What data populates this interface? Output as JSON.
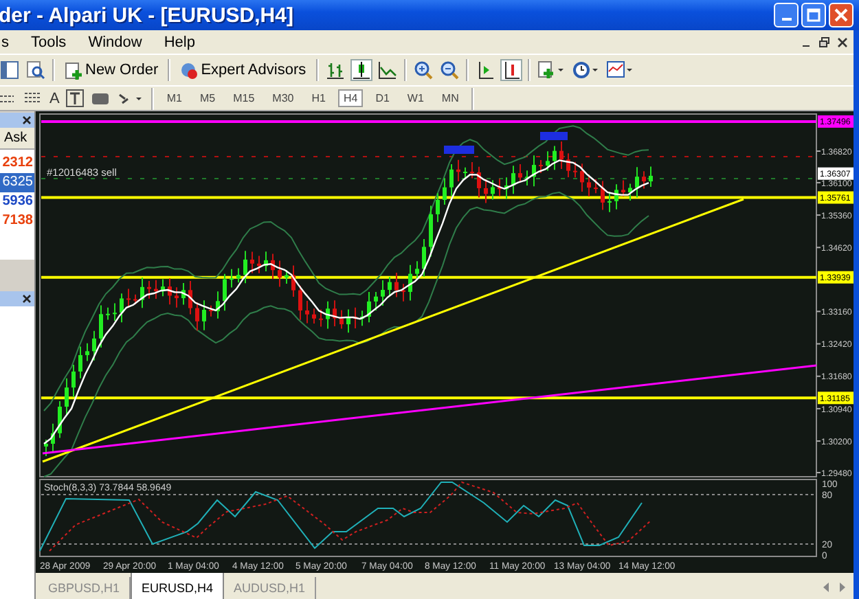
{
  "window": {
    "title": "der - Alpari UK - [EURUSD,H4]"
  },
  "menu": [
    "s",
    "Tools",
    "Window",
    "Help"
  ],
  "toolbar": {
    "buttons": [
      {
        "label": "New Order"
      },
      {
        "label": "Expert Advisors"
      }
    ],
    "text_tool": "A"
  },
  "timeframes": [
    {
      "label": "M1",
      "selected": false
    },
    {
      "label": "M5",
      "selected": false
    },
    {
      "label": "M15",
      "selected": false
    },
    {
      "label": "M30",
      "selected": false
    },
    {
      "label": "H1",
      "selected": false
    },
    {
      "label": "H4",
      "selected": true
    },
    {
      "label": "D1",
      "selected": false
    },
    {
      "label": "W1",
      "selected": false
    },
    {
      "label": "MN",
      "selected": false
    }
  ],
  "market_watch": {
    "column": "Ask",
    "rows": [
      {
        "ask": "2312",
        "selected": false,
        "color": "#e8400c"
      },
      {
        "ask": "6325",
        "selected": true
      },
      {
        "ask": "5936",
        "selected": false,
        "color": "#1c48c4"
      },
      {
        "ask": "7138",
        "selected": false,
        "color": "#e8400c"
      }
    ]
  },
  "chart": {
    "order_label": "#12016483 sell",
    "price_axis": [
      {
        "text": "1.37496",
        "kind": "level",
        "color": "#ff00ff"
      },
      {
        "text": "1.36820",
        "kind": "tick"
      },
      {
        "text": "1.36307",
        "kind": "bid"
      },
      {
        "text": "1.36100",
        "kind": "tick"
      },
      {
        "text": "1.35761",
        "kind": "level",
        "color": "#ffff00"
      },
      {
        "text": "1.35360",
        "kind": "tick"
      },
      {
        "text": "1.34620",
        "kind": "tick"
      },
      {
        "text": "1.33939",
        "kind": "level",
        "color": "#ffff00"
      },
      {
        "text": "1.33160",
        "kind": "tick"
      },
      {
        "text": "1.32420",
        "kind": "tick"
      },
      {
        "text": "1.31680",
        "kind": "tick"
      },
      {
        "text": "1.31185",
        "kind": "level",
        "color": "#ffff00"
      },
      {
        "text": "1.30940",
        "kind": "tick"
      },
      {
        "text": "1.30200",
        "kind": "tick"
      },
      {
        "text": "1.29480",
        "kind": "tick"
      }
    ],
    "indicator": {
      "label": "Stoch(8,3,3) 73.7844 58.9649",
      "axis": [
        "100",
        "80",
        "20",
        "0"
      ]
    },
    "time_axis": [
      "28 Apr 2009",
      "29 Apr 20:00",
      "1 May 04:00",
      "4 May 12:00",
      "5 May 20:00",
      "7 May 04:00",
      "8 May 12:00",
      "11 May 20:00",
      "13 May 04:00",
      "14 May 12:00"
    ]
  },
  "tabs": [
    {
      "label": "GBPUSD,H1",
      "selected": false
    },
    {
      "label": "EURUSD,H4",
      "selected": true
    },
    {
      "label": "AUDUSD,H1",
      "selected": false
    }
  ]
}
